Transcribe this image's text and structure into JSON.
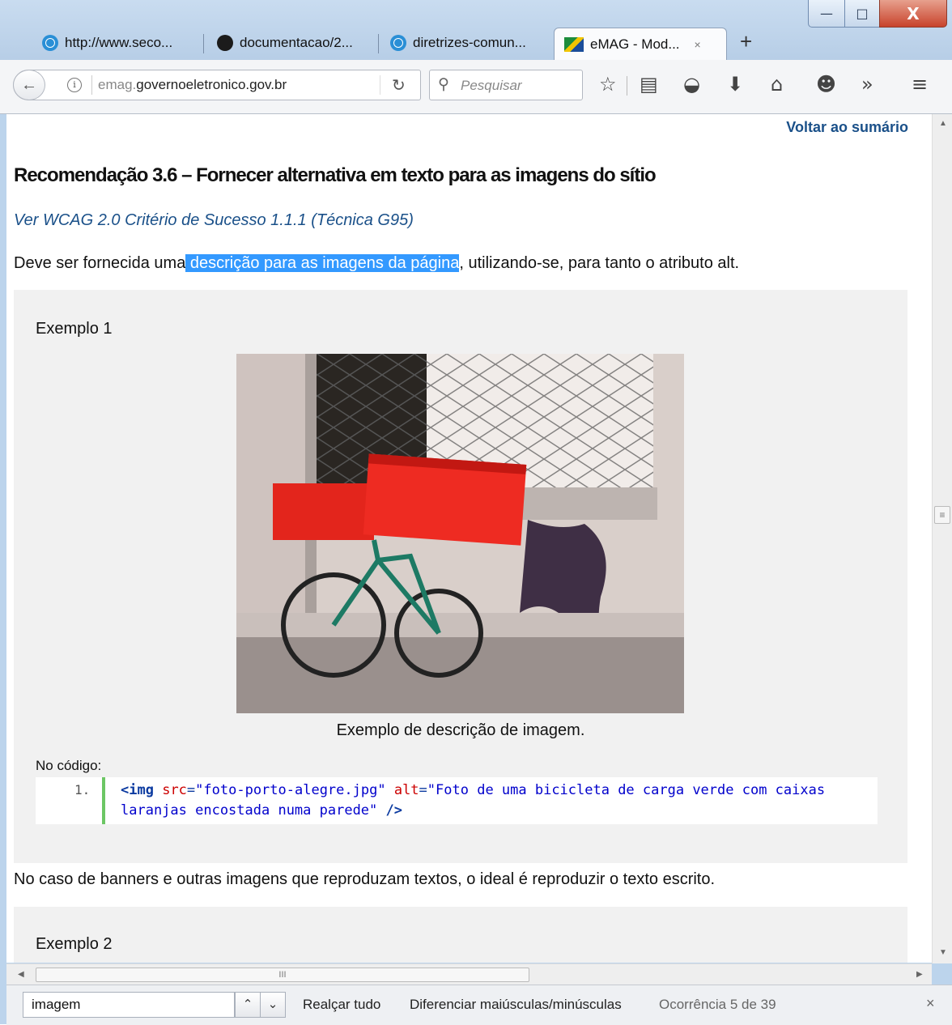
{
  "window": {
    "minimize": "—",
    "maximize": "□",
    "close": "X"
  },
  "tabs": [
    {
      "label": "http://www.seco...",
      "icon": "globe-icon"
    },
    {
      "label": "documentacao/2...",
      "icon": "github-icon"
    },
    {
      "label": "diretrizes-comun...",
      "icon": "globe-icon"
    },
    {
      "label": "eMAG - Mod...",
      "icon": "brazil-flag-icon",
      "close": "×",
      "active": true
    }
  ],
  "newtab": "+",
  "toolbar": {
    "url_grey": "emag.",
    "url_main": "governoeletronico.gov.br",
    "search_placeholder": "Pesquisar",
    "icons": [
      "bookmark-star-icon",
      "reading-list-icon",
      "pocket-icon",
      "download-icon",
      "home-icon",
      "emoji-icon",
      "overflow-icon",
      "menu-icon"
    ]
  },
  "page": {
    "back_link": "Voltar ao sumário",
    "heading": "Recomendação 3.6 – Fornecer alternativa em texto para as imagens do sítio",
    "wcag_link": "Ver WCAG 2.0 Critério de Sucesso 1.1.1 (Técnica G95)",
    "para1_before": "Deve ser fornecida uma",
    "para1_highlight": " descrição para as imagens da página",
    "para1_after": ", utilizando-se, para tanto o atributo alt.",
    "example1": {
      "title": "Exemplo 1",
      "caption": "Exemplo de descrição de imagem.",
      "code_label": "No código:",
      "line_number": "1.",
      "code": {
        "tag_open": "<img",
        "attr_src": "src",
        "eq": "=",
        "val_src": "\"foto-porto-alegre.jpg\"",
        "attr_alt": "alt",
        "val_alt": "\"Foto de uma bicicleta de carga verde com caixas laranjas encostada numa parede\"",
        "tag_close": "/>"
      }
    },
    "para2": "No caso de banners e outras imagens que reproduzam textos, o ideal é reproduzir o texto escrito.",
    "example2": {
      "title": "Exemplo 2"
    }
  },
  "findbar": {
    "query": "imagem",
    "highlight_all": "Realçar tudo",
    "match_case": "Diferenciar maiúsculas/minúsculas",
    "count": "Ocorrência 5 de 39",
    "close": "×"
  }
}
